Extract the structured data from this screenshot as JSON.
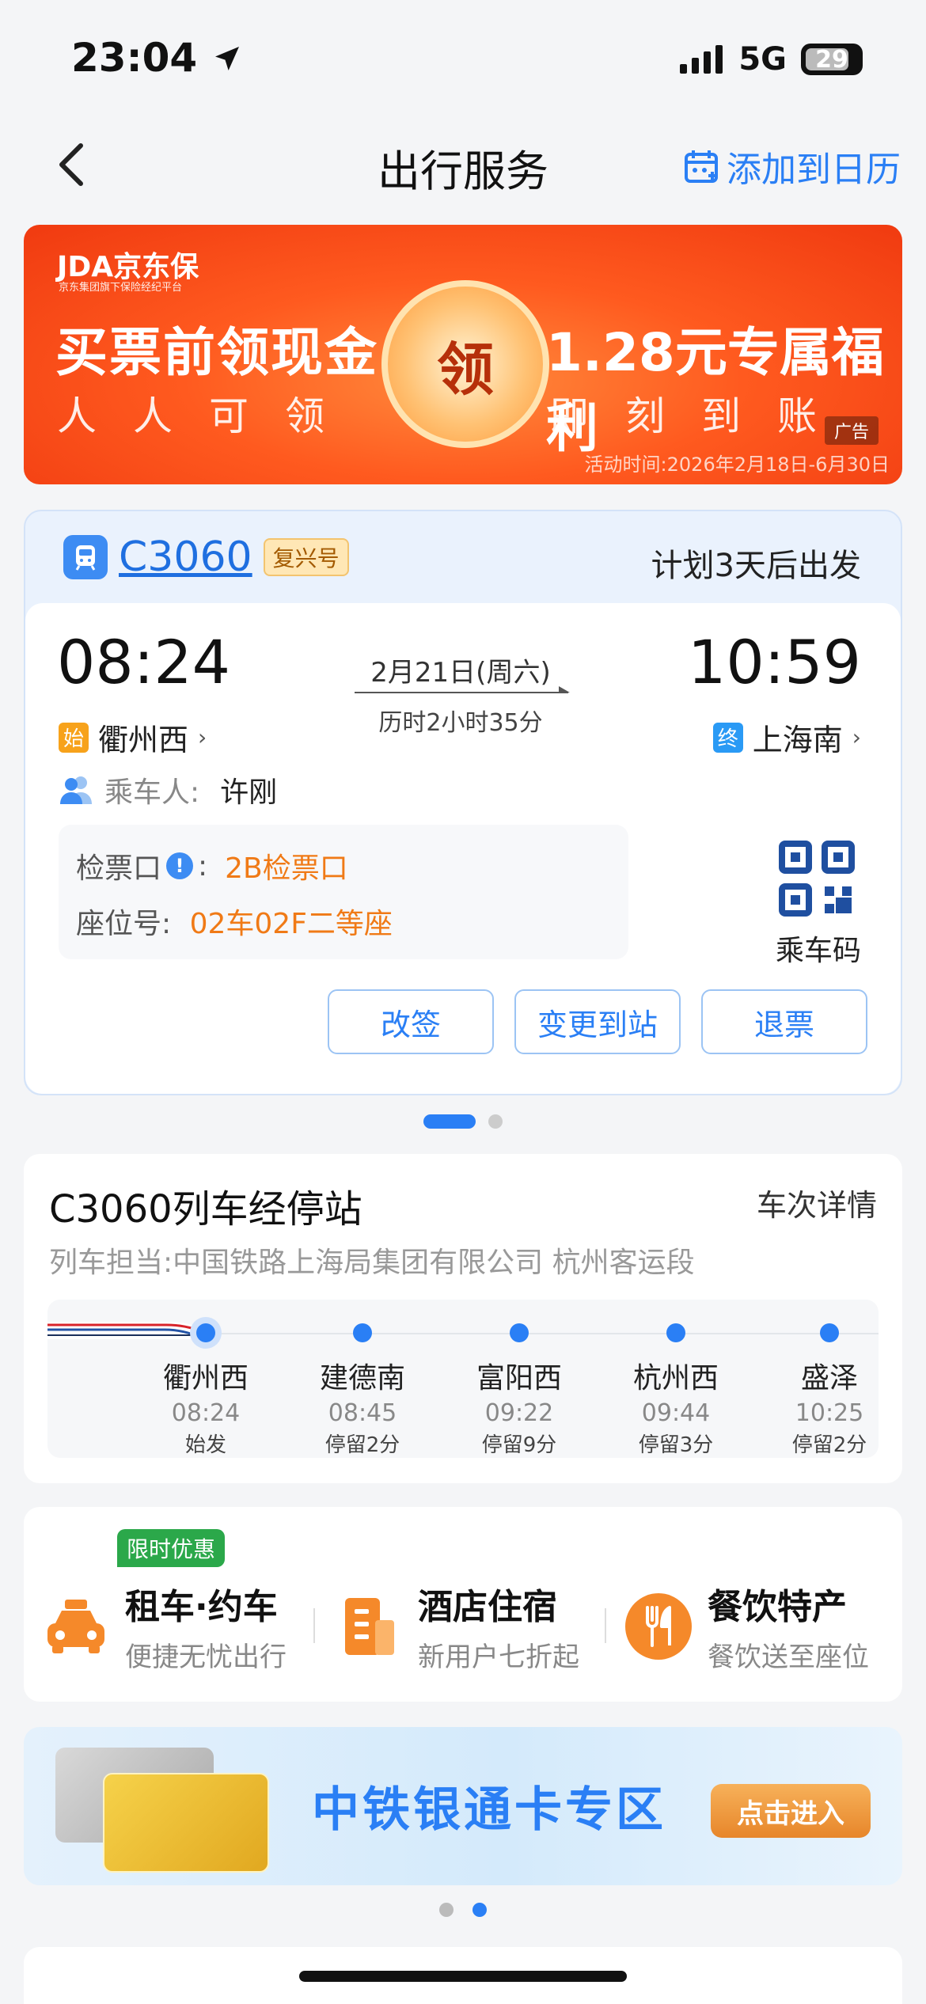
{
  "status_bar": {
    "time": "23:04",
    "network": "5G",
    "battery": "29"
  },
  "nav": {
    "title": "出行服务",
    "add_calendar": "添加到日历"
  },
  "ad": {
    "brand": "JDA京东保",
    "brand_sub": "京东集团旗下保险经纪平台",
    "left_main": "买票前领现金",
    "left_sub": "人人可领",
    "center": "领",
    "right_main": "1.28元专属福利",
    "right_sub": "即刻到账",
    "tag": "广告",
    "period": "活动时间:2026年2月18日-6月30日"
  },
  "trip": {
    "train_no": "C3060",
    "train_type": "复兴号",
    "plan": "计划3天后出发",
    "dep_time": "08:24",
    "arr_time": "10:59",
    "date": "2月21日(周六)",
    "duration": "历时2小时35分",
    "dep_tag": "始",
    "dep_station": "衢州西",
    "arr_tag": "终",
    "arr_station": "上海南",
    "passenger_label": "乘车人:",
    "passenger_name": "许刚",
    "gate_label": "检票口",
    "gate_value": "2B检票口",
    "seat_label": "座位号:",
    "seat_value": "02车02F二等座",
    "qr_label": "乘车码",
    "buttons": [
      "改签",
      "变更到站",
      "退票"
    ]
  },
  "stops": {
    "title": "C3060列车经停站",
    "detail_link": "车次详情",
    "operator": "列车担当:中国铁路上海局集团有限公司 杭州客运段",
    "list": [
      {
        "name": "衢州西",
        "time": "08:24",
        "note": "始发"
      },
      {
        "name": "建德南",
        "time": "08:45",
        "note": "停留2分"
      },
      {
        "name": "富阳西",
        "time": "09:22",
        "note": "停留9分"
      },
      {
        "name": "杭州西",
        "time": "09:44",
        "note": "停留3分"
      },
      {
        "name": "盛泽",
        "time": "10:25",
        "note": "停留2分"
      }
    ]
  },
  "services": {
    "promo": "限时优惠",
    "items": [
      {
        "title": "租车·约车",
        "sub": "便捷无忧出行",
        "icon": "car-icon",
        "color": "#f5892a"
      },
      {
        "title": "酒店住宿",
        "sub": "新用户七折起",
        "icon": "hotel-icon",
        "color": "#f5892a"
      },
      {
        "title": "餐饮特产",
        "sub": "餐饮送至座位",
        "icon": "food-icon",
        "color": "#f5892a"
      }
    ]
  },
  "bank": {
    "title": "中铁银通卡专区",
    "button": "点击进入"
  },
  "colors": {
    "accent": "#2a7ff5",
    "orange": "#f07a16",
    "ad_red": "#f03a10"
  }
}
